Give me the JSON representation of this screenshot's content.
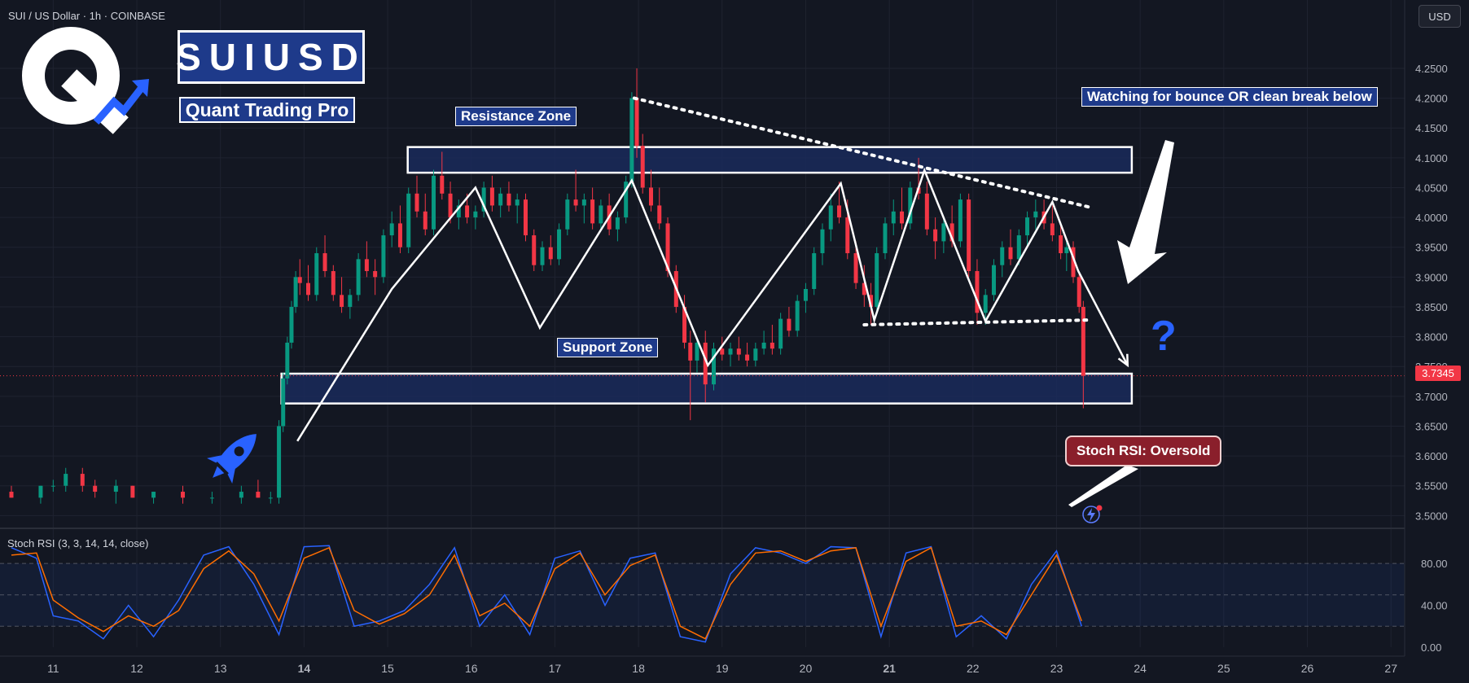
{
  "header": {
    "symbol_label": "SUI / US Dollar · 1h · COINBASE",
    "currency_button": "USD"
  },
  "branding": {
    "title": "SUIUSD",
    "subtitle": "Quant Trading Pro",
    "logo_icon": "q-logo-arrow-icon",
    "rocket_icon": "rocket-icon",
    "accent_color": "#2962ff",
    "box_color": "#1e3a8a"
  },
  "annotations": {
    "resistance": "Resistance Zone",
    "support": "Support Zone",
    "watching": "Watching for bounce OR clean break below",
    "stoch_note": "Stoch RSI: Oversold",
    "question": "?"
  },
  "colors": {
    "background": "#131722",
    "up": "#089981",
    "down": "#f23645",
    "k_line": "#2962ff",
    "d_line": "#ff6d00",
    "zone_fill": "#1a2a5a"
  },
  "chart_data": [
    {
      "type": "candlestick",
      "title": "SUI / US Dollar · 1h · COINBASE",
      "x_ticks": [
        {
          "label": "11",
          "day": 11
        },
        {
          "label": "12",
          "day": 12
        },
        {
          "label": "13",
          "day": 13
        },
        {
          "label": "14",
          "day": 14
        },
        {
          "label": "15",
          "day": 15
        },
        {
          "label": "16",
          "day": 16
        },
        {
          "label": "17",
          "day": 17
        },
        {
          "label": "18",
          "day": 18
        },
        {
          "label": "19",
          "day": 19
        },
        {
          "label": "20",
          "day": 20
        },
        {
          "label": "21",
          "day": 21
        },
        {
          "label": "22",
          "day": 22
        },
        {
          "label": "23",
          "day": 23
        },
        {
          "label": "24",
          "day": 24
        },
        {
          "label": "25",
          "day": 25
        },
        {
          "label": "26",
          "day": 26
        },
        {
          "label": "27",
          "day": 27
        }
      ],
      "bold_ticks": [
        "14",
        "21"
      ],
      "x_range": [
        10.5,
        27.3
      ],
      "y_ticks": [
        "4.2500",
        "4.2000",
        "4.1500",
        "4.1000",
        "4.0500",
        "4.0000",
        "3.9500",
        "3.9000",
        "3.8500",
        "3.8000",
        "3.7500",
        "3.7000",
        "3.6500",
        "3.6000",
        "3.5500",
        "3.5000"
      ],
      "ylim": [
        3.48,
        4.31
      ],
      "last_price": "3.7345",
      "zones": [
        {
          "name": "Resistance Zone",
          "from_day": 15.24,
          "to_day": 23.9,
          "low": 4.075,
          "high": 4.118
        },
        {
          "name": "Support Zone",
          "from_day": 13.73,
          "to_day": 23.9,
          "low": 3.688,
          "high": 3.738
        }
      ],
      "zigzag": [
        [
          13.92,
          3.625
        ],
        [
          15.05,
          3.88
        ],
        [
          16.05,
          4.05
        ],
        [
          16.82,
          3.815
        ],
        [
          17.92,
          4.062
        ],
        [
          18.83,
          3.752
        ],
        [
          20.42,
          4.057
        ],
        [
          20.82,
          3.828
        ],
        [
          21.42,
          4.079
        ],
        [
          22.15,
          3.826
        ],
        [
          22.95,
          4.026
        ],
        [
          23.26,
          3.91
        ],
        [
          23.85,
          3.752
        ]
      ],
      "trendline_desc": [
        [
          17.95,
          4.2
        ],
        [
          23.4,
          4.017
        ]
      ],
      "neckline": [
        [
          20.7,
          3.82
        ],
        [
          23.4,
          3.828
        ]
      ],
      "candles": [
        [
          10.5,
          3.54,
          3.55,
          3.53,
          3.53
        ],
        [
          10.85,
          3.53,
          3.55,
          3.52,
          3.55
        ],
        [
          11.0,
          3.55,
          3.56,
          3.54,
          3.55
        ],
        [
          11.15,
          3.55,
          3.58,
          3.54,
          3.57
        ],
        [
          11.35,
          3.57,
          3.58,
          3.54,
          3.55
        ],
        [
          11.5,
          3.55,
          3.56,
          3.53,
          3.54
        ],
        [
          11.75,
          3.54,
          3.56,
          3.52,
          3.55
        ],
        [
          11.95,
          3.55,
          3.55,
          3.53,
          3.53
        ],
        [
          12.2,
          3.53,
          3.54,
          3.52,
          3.54
        ],
        [
          12.55,
          3.54,
          3.55,
          3.52,
          3.53
        ],
        [
          12.9,
          3.53,
          3.54,
          3.52,
          3.53
        ],
        [
          13.25,
          3.53,
          3.55,
          3.52,
          3.54
        ],
        [
          13.45,
          3.54,
          3.56,
          3.53,
          3.53
        ],
        [
          13.6,
          3.53,
          3.54,
          3.52,
          3.53
        ],
        [
          13.7,
          3.53,
          3.66,
          3.52,
          3.65
        ],
        [
          13.75,
          3.65,
          3.74,
          3.64,
          3.73
        ],
        [
          13.8,
          3.73,
          3.8,
          3.72,
          3.79
        ],
        [
          13.85,
          3.79,
          3.86,
          3.78,
          3.85
        ],
        [
          13.9,
          3.85,
          3.91,
          3.84,
          3.9
        ],
        [
          13.95,
          3.9,
          3.93,
          3.87,
          3.89
        ],
        [
          14.05,
          3.89,
          3.92,
          3.86,
          3.87
        ],
        [
          14.15,
          3.87,
          3.95,
          3.86,
          3.94
        ],
        [
          14.25,
          3.94,
          3.97,
          3.9,
          3.91
        ],
        [
          14.35,
          3.91,
          3.92,
          3.86,
          3.87
        ],
        [
          14.45,
          3.87,
          3.9,
          3.84,
          3.85
        ],
        [
          14.55,
          3.85,
          3.88,
          3.83,
          3.87
        ],
        [
          14.65,
          3.87,
          3.94,
          3.86,
          3.93
        ],
        [
          14.75,
          3.93,
          3.96,
          3.9,
          3.91
        ],
        [
          14.85,
          3.91,
          3.93,
          3.87,
          3.9
        ],
        [
          14.95,
          3.9,
          3.98,
          3.89,
          3.97
        ],
        [
          15.05,
          3.97,
          4.01,
          3.95,
          3.99
        ],
        [
          15.15,
          3.99,
          4.02,
          3.94,
          3.95
        ],
        [
          15.25,
          3.95,
          4.05,
          3.94,
          4.04
        ],
        [
          15.35,
          4.04,
          4.07,
          4.0,
          4.01
        ],
        [
          15.45,
          4.01,
          4.04,
          3.97,
          3.98
        ],
        [
          15.55,
          3.98,
          4.08,
          3.97,
          4.07
        ],
        [
          15.65,
          4.07,
          4.11,
          4.03,
          4.04
        ],
        [
          15.75,
          4.04,
          4.06,
          3.99,
          4.0
        ],
        [
          15.85,
          4.0,
          4.03,
          3.98,
          4.02
        ],
        [
          15.95,
          4.02,
          4.04,
          3.99,
          4.0
        ],
        [
          16.05,
          4.0,
          4.02,
          3.98,
          4.01
        ],
        [
          16.15,
          4.01,
          4.06,
          4.0,
          4.05
        ],
        [
          16.25,
          4.05,
          4.07,
          4.01,
          4.02
        ],
        [
          16.35,
          4.02,
          4.05,
          4.0,
          4.04
        ],
        [
          16.45,
          4.04,
          4.06,
          4.01,
          4.02
        ],
        [
          16.55,
          4.02,
          4.04,
          3.99,
          4.03
        ],
        [
          16.65,
          4.03,
          4.04,
          3.96,
          3.97
        ],
        [
          16.75,
          3.97,
          3.98,
          3.91,
          3.92
        ],
        [
          16.85,
          3.92,
          3.96,
          3.91,
          3.95
        ],
        [
          16.95,
          3.95,
          3.97,
          3.92,
          3.93
        ],
        [
          17.05,
          3.93,
          3.99,
          3.92,
          3.98
        ],
        [
          17.15,
          3.98,
          4.04,
          3.97,
          4.03
        ],
        [
          17.25,
          4.03,
          4.08,
          4.01,
          4.02
        ],
        [
          17.35,
          4.02,
          4.04,
          3.99,
          4.03
        ],
        [
          17.45,
          4.03,
          4.05,
          3.98,
          3.99
        ],
        [
          17.55,
          3.99,
          4.03,
          3.98,
          4.02
        ],
        [
          17.65,
          4.02,
          4.04,
          3.97,
          3.98
        ],
        [
          17.75,
          3.98,
          4.01,
          3.96,
          4.0
        ],
        [
          17.85,
          4.0,
          4.07,
          3.99,
          4.06
        ],
        [
          17.92,
          4.06,
          4.21,
          4.05,
          4.2
        ],
        [
          17.98,
          4.2,
          4.25,
          4.1,
          4.12
        ],
        [
          18.05,
          4.12,
          4.14,
          4.04,
          4.05
        ],
        [
          18.15,
          4.05,
          4.08,
          4.01,
          4.02
        ],
        [
          18.25,
          4.02,
          4.05,
          3.98,
          3.99
        ],
        [
          18.35,
          3.99,
          4.0,
          3.9,
          3.91
        ],
        [
          18.45,
          3.91,
          3.92,
          3.84,
          3.85
        ],
        [
          18.55,
          3.85,
          3.87,
          3.78,
          3.79
        ],
        [
          18.62,
          3.79,
          3.81,
          3.66,
          3.76
        ],
        [
          18.7,
          3.76,
          3.8,
          3.74,
          3.79
        ],
        [
          18.8,
          3.79,
          3.81,
          3.69,
          3.72
        ],
        [
          18.9,
          3.72,
          3.79,
          3.71,
          3.78
        ],
        [
          19.0,
          3.78,
          3.8,
          3.76,
          3.77
        ],
        [
          19.1,
          3.77,
          3.79,
          3.75,
          3.78
        ],
        [
          19.2,
          3.78,
          3.8,
          3.76,
          3.77
        ],
        [
          19.3,
          3.77,
          3.79,
          3.75,
          3.76
        ],
        [
          19.4,
          3.76,
          3.79,
          3.75,
          3.78
        ],
        [
          19.5,
          3.78,
          3.81,
          3.77,
          3.79
        ],
        [
          19.6,
          3.79,
          3.82,
          3.77,
          3.78
        ],
        [
          19.7,
          3.78,
          3.84,
          3.77,
          3.83
        ],
        [
          19.8,
          3.83,
          3.85,
          3.8,
          3.81
        ],
        [
          19.9,
          3.81,
          3.87,
          3.8,
          3.86
        ],
        [
          20.0,
          3.86,
          3.89,
          3.84,
          3.88
        ],
        [
          20.1,
          3.88,
          3.95,
          3.87,
          3.94
        ],
        [
          20.2,
          3.94,
          3.99,
          3.92,
          3.98
        ],
        [
          20.3,
          3.98,
          4.04,
          3.96,
          4.02
        ],
        [
          20.4,
          4.02,
          4.06,
          3.99,
          4.0
        ],
        [
          20.5,
          4.0,
          4.03,
          3.93,
          3.94
        ],
        [
          20.6,
          3.94,
          3.96,
          3.88,
          3.89
        ],
        [
          20.7,
          3.89,
          3.92,
          3.85,
          3.87
        ],
        [
          20.78,
          3.87,
          3.89,
          3.82,
          3.85
        ],
        [
          20.85,
          3.85,
          3.95,
          3.84,
          3.94
        ],
        [
          20.95,
          3.94,
          4.0,
          3.93,
          3.99
        ],
        [
          21.05,
          3.99,
          4.03,
          3.97,
          4.01
        ],
        [
          21.15,
          4.01,
          4.05,
          3.98,
          3.99
        ],
        [
          21.25,
          3.99,
          4.06,
          3.98,
          4.05
        ],
        [
          21.35,
          4.05,
          4.1,
          4.03,
          4.04
        ],
        [
          21.45,
          4.04,
          4.06,
          3.97,
          3.98
        ],
        [
          21.55,
          3.98,
          4.0,
          3.93,
          3.96
        ],
        [
          21.65,
          3.96,
          4.0,
          3.94,
          3.99
        ],
        [
          21.75,
          3.99,
          4.02,
          3.95,
          3.96
        ],
        [
          21.85,
          3.96,
          4.04,
          3.95,
          4.03
        ],
        [
          21.95,
          4.03,
          4.04,
          3.9,
          3.91
        ],
        [
          22.05,
          3.91,
          3.93,
          3.82,
          3.84
        ],
        [
          22.15,
          3.84,
          3.88,
          3.82,
          3.87
        ],
        [
          22.25,
          3.87,
          3.93,
          3.86,
          3.92
        ],
        [
          22.35,
          3.92,
          3.96,
          3.9,
          3.95
        ],
        [
          22.45,
          3.95,
          3.98,
          3.92,
          3.93
        ],
        [
          22.55,
          3.93,
          3.98,
          3.92,
          3.97
        ],
        [
          22.65,
          3.97,
          4.01,
          3.95,
          4.0
        ],
        [
          22.75,
          4.0,
          4.03,
          3.98,
          4.01
        ],
        [
          22.85,
          4.01,
          4.03,
          3.98,
          3.99
        ],
        [
          22.95,
          3.99,
          4.02,
          3.96,
          3.97
        ],
        [
          23.05,
          3.97,
          3.99,
          3.93,
          3.94
        ],
        [
          23.12,
          3.94,
          3.96,
          3.91,
          3.95
        ],
        [
          23.2,
          3.95,
          3.96,
          3.89,
          3.9
        ],
        [
          23.27,
          3.9,
          3.91,
          3.84,
          3.85
        ],
        [
          23.32,
          3.85,
          3.86,
          3.68,
          3.7345
        ]
      ]
    },
    {
      "type": "line",
      "title": "Stoch RSI (3, 3, 14, 14, close)",
      "y_ticks": [
        "80.00",
        "40.00",
        "0.00"
      ],
      "ylim": [
        0,
        105
      ],
      "band": [
        20,
        80
      ],
      "mid": 50,
      "series": [
        {
          "name": "K",
          "color": "#2962ff",
          "x": [
            10.5,
            10.8,
            11.0,
            11.3,
            11.6,
            11.9,
            12.2,
            12.5,
            12.8,
            13.1,
            13.4,
            13.7,
            14.0,
            14.3,
            14.6,
            14.9,
            15.2,
            15.5,
            15.8,
            16.1,
            16.4,
            16.7,
            17.0,
            17.3,
            17.6,
            17.9,
            18.2,
            18.5,
            18.8,
            19.1,
            19.4,
            19.7,
            20.0,
            20.3,
            20.6,
            20.9,
            21.2,
            21.5,
            21.8,
            22.1,
            22.4,
            22.7,
            23.0,
            23.3
          ],
          "values": [
            95,
            85,
            30,
            25,
            8,
            40,
            10,
            45,
            88,
            96,
            60,
            12,
            96,
            97,
            20,
            25,
            35,
            60,
            95,
            20,
            50,
            12,
            85,
            92,
            40,
            85,
            90,
            10,
            5,
            70,
            95,
            90,
            80,
            96,
            95,
            10,
            90,
            96,
            10,
            30,
            8,
            60,
            92,
            20
          ]
        },
        {
          "name": "D",
          "color": "#ff6d00",
          "x": [
            10.5,
            10.8,
            11.0,
            11.3,
            11.6,
            11.9,
            12.2,
            12.5,
            12.8,
            13.1,
            13.4,
            13.7,
            14.0,
            14.3,
            14.6,
            14.9,
            15.2,
            15.5,
            15.8,
            16.1,
            16.4,
            16.7,
            17.0,
            17.3,
            17.6,
            17.9,
            18.2,
            18.5,
            18.8,
            19.1,
            19.4,
            19.7,
            20.0,
            20.3,
            20.6,
            20.9,
            21.2,
            21.5,
            21.8,
            22.1,
            22.4,
            22.7,
            23.0,
            23.3
          ],
          "values": [
            88,
            90,
            45,
            28,
            15,
            30,
            20,
            35,
            75,
            92,
            70,
            25,
            85,
            95,
            35,
            22,
            32,
            50,
            88,
            30,
            42,
            20,
            75,
            90,
            50,
            78,
            88,
            20,
            8,
            60,
            90,
            92,
            82,
            92,
            95,
            20,
            82,
            95,
            20,
            25,
            12,
            50,
            88,
            25
          ]
        }
      ]
    }
  ]
}
